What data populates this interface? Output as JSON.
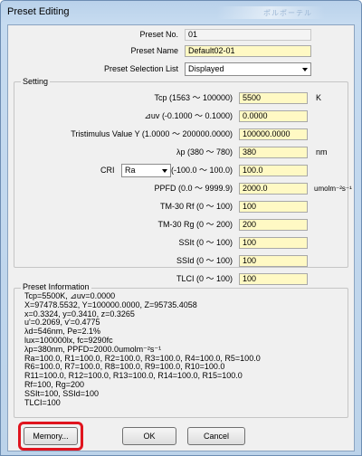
{
  "window": {
    "title": "Preset Editing",
    "title_glow_text": "ポルポーテル"
  },
  "header": {
    "preset_no_label": "Preset No.",
    "preset_no_value": "01",
    "preset_name_label": "Preset Name",
    "preset_name_value": "Default02-01",
    "selection_list_label": "Preset Selection List",
    "selection_list_value": "Displayed"
  },
  "setting": {
    "title": "Setting",
    "tcp": {
      "label": "Tcp (1563 ～ 100000)",
      "value": "5500",
      "unit": "K"
    },
    "duv": {
      "label": "⊿uv (-0.1000 ～ 0.1000)",
      "value": "0.0000"
    },
    "tristimulus": {
      "label": "Tristimulus Value Y (1.0000 ～ 200000.0000)",
      "value": "100000.0000"
    },
    "lambda_p": {
      "label": "λp (380 ～ 780)",
      "value": "380",
      "unit": "nm"
    },
    "cri": {
      "label": "CRI",
      "select_value": "Ra",
      "range": "(-100.0 ～ 100.0)",
      "value": "100.0"
    },
    "ppfd": {
      "label": "PPFD (0.0 ～ 9999.9)",
      "value": "2000.0",
      "unit": "umolm⁻²s⁻¹"
    },
    "tm30_rf": {
      "label": "TM-30 Rf (0 ～ 100)",
      "value": "100"
    },
    "tm30_rg": {
      "label": "TM-30 Rg (0 ～ 200)",
      "value": "200"
    },
    "sslt": {
      "label": "SSIt (0 ～ 100)",
      "value": "100"
    },
    "ssld": {
      "label": "SSId (0 ～ 100)",
      "value": "100"
    },
    "tlci": {
      "label": "TLCI (0 ～ 100)",
      "value": "100"
    }
  },
  "preset_information": {
    "title": "Preset Information",
    "lines": [
      "Tcp=5500K, ⊿uv=0.0000",
      "X=97478.5532, Y=100000.0000, Z=95735.4058",
      "x=0.3324, y=0.3410, z=0.3265",
      "u'=0.2069, v'=0.4775",
      "λd=546nm, Pe=2.1%",
      "lux=100000lx, fc=9290fc",
      "λp=380nm, PPFD=2000.0umolm⁻²s⁻¹",
      "Ra=100.0, R1=100.0, R2=100.0, R3=100.0, R4=100.0, R5=100.0",
      "R6=100.0, R7=100.0, R8=100.0, R9=100.0, R10=100.0",
      "R11=100.0, R12=100.0, R13=100.0, R14=100.0, R15=100.0",
      "Rf=100, Rg=200",
      "SSIt=100, SSId=100",
      "TLCI=100"
    ]
  },
  "buttons": {
    "memory": "Memory...",
    "ok": "OK",
    "cancel": "Cancel"
  },
  "colors": {
    "field_bg": "#fff9c4",
    "highlight": "#e0141e"
  }
}
